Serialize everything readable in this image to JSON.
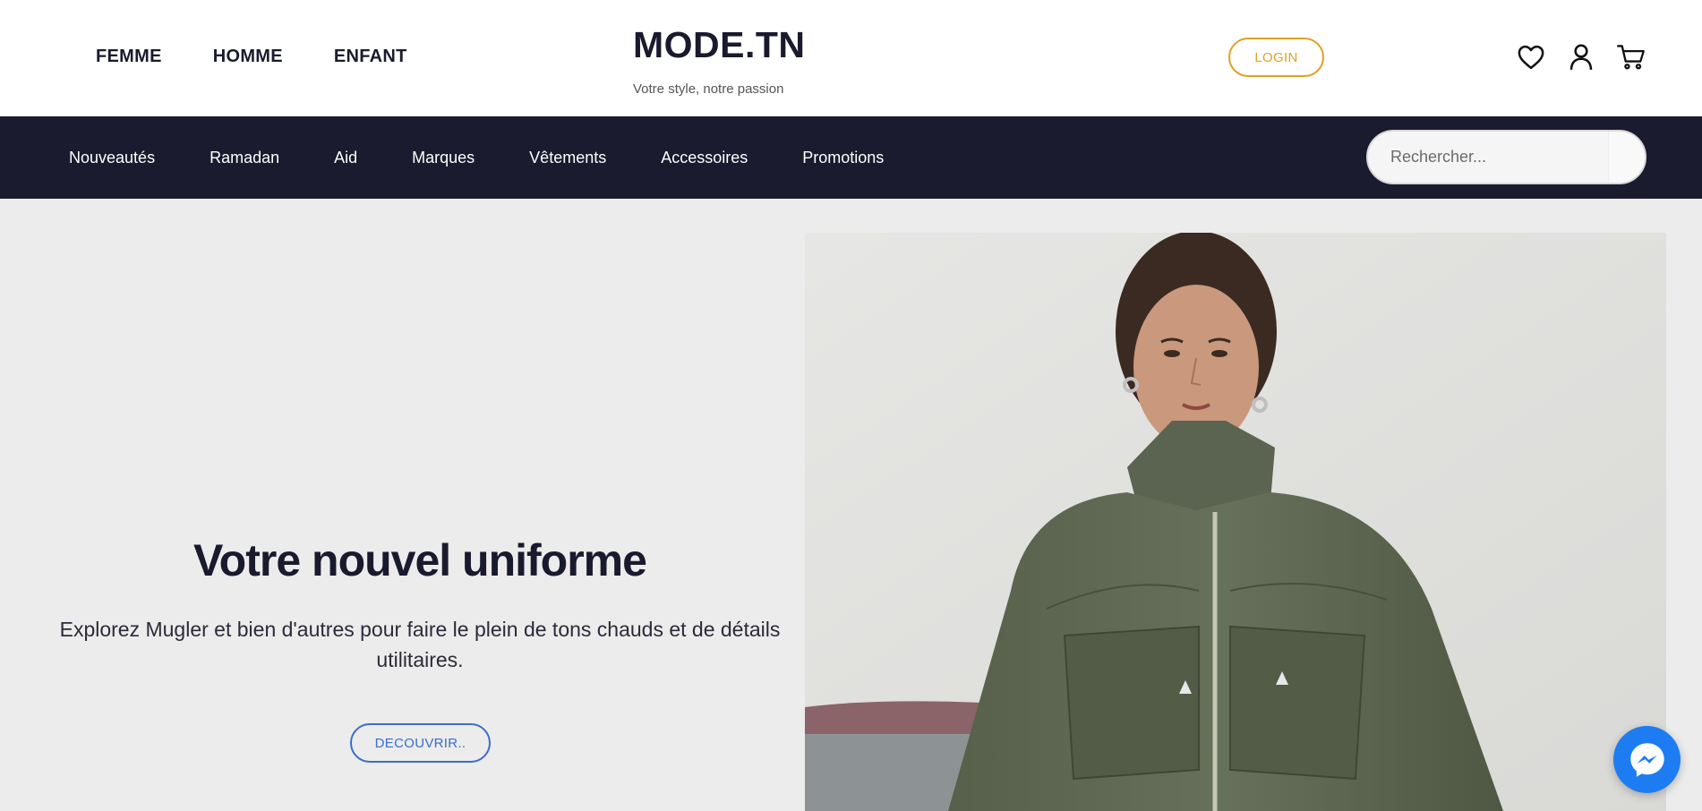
{
  "header": {
    "gender_nav": [
      "FEMME",
      "HOMME",
      "ENFANT"
    ],
    "brand_title": "MODE.TN",
    "brand_tagline": "Votre style, notre passion",
    "login_label": "LOGIN",
    "icons": [
      "heart-icon",
      "user-icon",
      "cart-icon"
    ],
    "accent_color": "#e0a125"
  },
  "category_nav": {
    "items": [
      "Nouveautés",
      "Ramadan",
      "Aid",
      "Marques",
      "Vêtements",
      "Accessoires",
      "Promotions"
    ],
    "background": "#1a1b2e"
  },
  "search": {
    "placeholder": "Rechercher..."
  },
  "hero": {
    "title": "Votre nouvel uniforme",
    "subtitle": "Explorez Mugler et bien d'autres pour faire le plein de tons chauds et de détails utilitaires.",
    "cta_label": "DECOUVRIR..",
    "cta_color": "#3a6ec9",
    "image_description_icon": "model-photo"
  },
  "chat_widget": {
    "icon": "messenger-icon",
    "color": "#1e7cf2"
  }
}
